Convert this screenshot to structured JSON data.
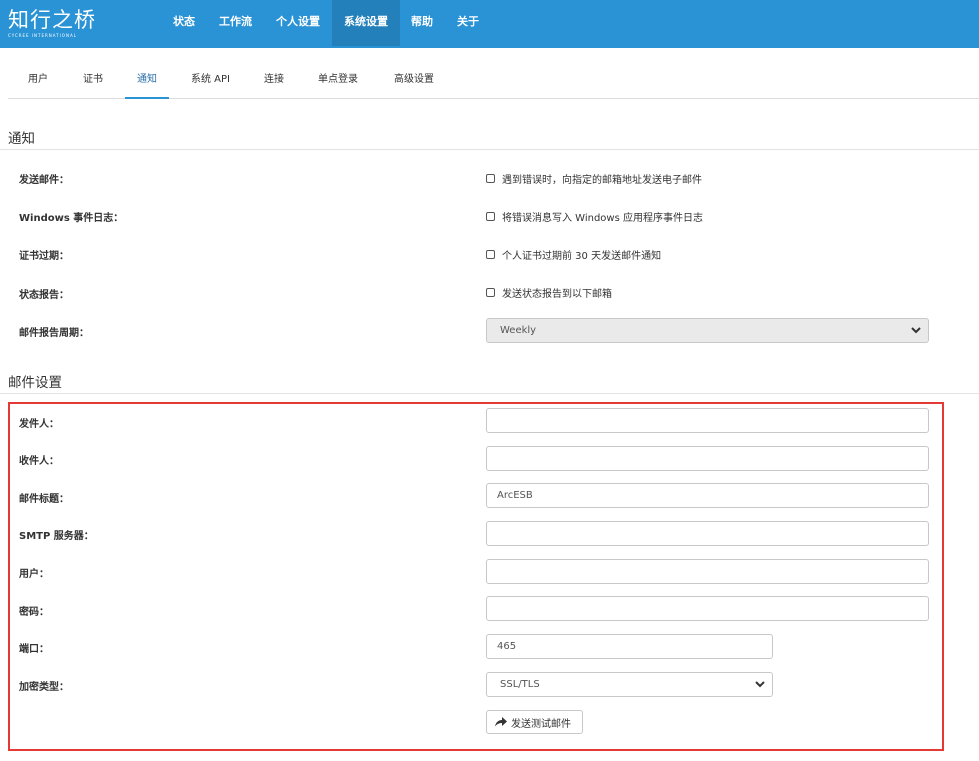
{
  "brand": {
    "name": "知行之桥",
    "tagline": "CYCREE INTERNATIONAL"
  },
  "nav": {
    "items": [
      "状态",
      "工作流",
      "个人设置",
      "系统设置",
      "帮助",
      "关于"
    ],
    "active": "系统设置"
  },
  "subtabs": {
    "items": [
      "用户",
      "证书",
      "通知",
      "系统 API",
      "连接",
      "单点登录",
      "高级设置"
    ],
    "active": "通知"
  },
  "notifications": {
    "title": "通知",
    "send_email": {
      "label": "发送邮件：",
      "option": "遇到错误时，向指定的邮箱地址发送电子邮件",
      "checked": false
    },
    "windows_log": {
      "label": "Windows 事件日志：",
      "option": "将错误消息写入 Windows 应用程序事件日志",
      "checked": false
    },
    "cert_expiry": {
      "label": "证书过期：",
      "option": "个人证书过期前 30 天发送邮件通知",
      "checked": false
    },
    "status_report": {
      "label": "状态报告：",
      "option": "发送状态报告到以下邮箱",
      "checked": false
    },
    "report_period": {
      "label": "邮件报告周期：",
      "value": "Weekly"
    }
  },
  "mail": {
    "title": "邮件设置",
    "sender": {
      "label": "发件人：",
      "value": ""
    },
    "recipient": {
      "label": "收件人：",
      "value": ""
    },
    "subject": {
      "label": "邮件标题：",
      "value": "ArcESB"
    },
    "smtp": {
      "label": "SMTP 服务器：",
      "value": ""
    },
    "user": {
      "label": "用户：",
      "value": ""
    },
    "password": {
      "label": "密码：",
      "value": ""
    },
    "port": {
      "label": "端口：",
      "value": "465"
    },
    "encryption": {
      "label": "加密类型：",
      "value": "SSL/TLS"
    },
    "test_button": "发送测试邮件"
  },
  "colors": {
    "topbar": "#2a93d5",
    "nav_active": "#2480bb",
    "highlight": "#e53935"
  }
}
